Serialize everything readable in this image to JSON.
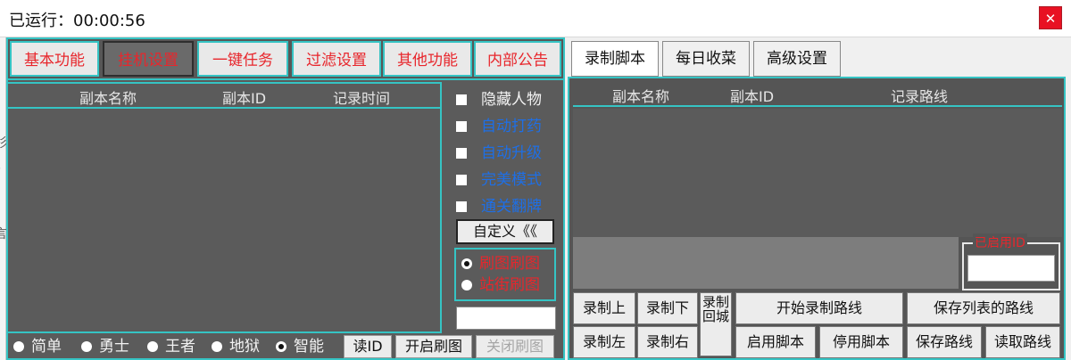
{
  "window": {
    "title": "已运行：00:00:56",
    "close_glyph": "✕"
  },
  "edge_fragments": [
    "杉",
    "•",
    "言"
  ],
  "left_tabs": [
    {
      "label": "基本功能",
      "active": false
    },
    {
      "label": "挂机设置",
      "active": true
    },
    {
      "label": "一键任务",
      "active": false
    },
    {
      "label": "过滤设置",
      "active": false
    },
    {
      "label": "其他功能",
      "active": false
    },
    {
      "label": "内部公告",
      "active": false
    }
  ],
  "left_list": {
    "columns": [
      "副本名称",
      "副本ID",
      "记录时间"
    ]
  },
  "side_options": {
    "checkboxes": [
      {
        "label": "隐藏人物",
        "checked": false,
        "color": "white"
      },
      {
        "label": "自动打药",
        "checked": false,
        "color": "blue"
      },
      {
        "label": "自动升级",
        "checked": false,
        "color": "blue"
      },
      {
        "label": "完美模式",
        "checked": false,
        "color": "blue"
      },
      {
        "label": "通关翻牌",
        "checked": false,
        "color": "blue"
      }
    ],
    "custom_button": "自定义《《",
    "mode_radios": [
      {
        "label": "刷图刷图",
        "selected": true
      },
      {
        "label": "站街刷图",
        "selected": false
      }
    ],
    "input_value": ""
  },
  "difficulty": [
    {
      "label": "简单",
      "selected": false
    },
    {
      "label": "勇士",
      "selected": false
    },
    {
      "label": "王者",
      "selected": false
    },
    {
      "label": "地狱",
      "selected": false
    },
    {
      "label": "智能",
      "selected": true
    }
  ],
  "left_buttons": {
    "read_id": "读ID",
    "start": "开启刷图",
    "stop": "关闭刷图"
  },
  "right_tabs": [
    {
      "label": "录制脚本",
      "active": true
    },
    {
      "label": "每日收菜",
      "active": false
    },
    {
      "label": "高级设置",
      "active": false
    }
  ],
  "right_list": {
    "columns": [
      "副本名称",
      "副本ID",
      "记录路线"
    ]
  },
  "enabled_id": {
    "title": "已启用ID",
    "value": ""
  },
  "right_buttons": {
    "rec_up": "录制上",
    "rec_down": "录制下",
    "rec_left": "录制左",
    "rec_right": "录制右",
    "rec_return": "录制回城",
    "start_rec": "开始录制路线",
    "save_list": "保存列表的路线",
    "enable_script": "启用脚本",
    "disable_script": "停用脚本",
    "save_route": "保存路线",
    "load_route": "读取路线"
  },
  "colors": {
    "accent_border": "#35c4c4",
    "tab_text_red": "#e8262c",
    "option_blue": "#1e6fe6",
    "panel_gray": "#5b5b5b",
    "close_red": "#e81123"
  }
}
